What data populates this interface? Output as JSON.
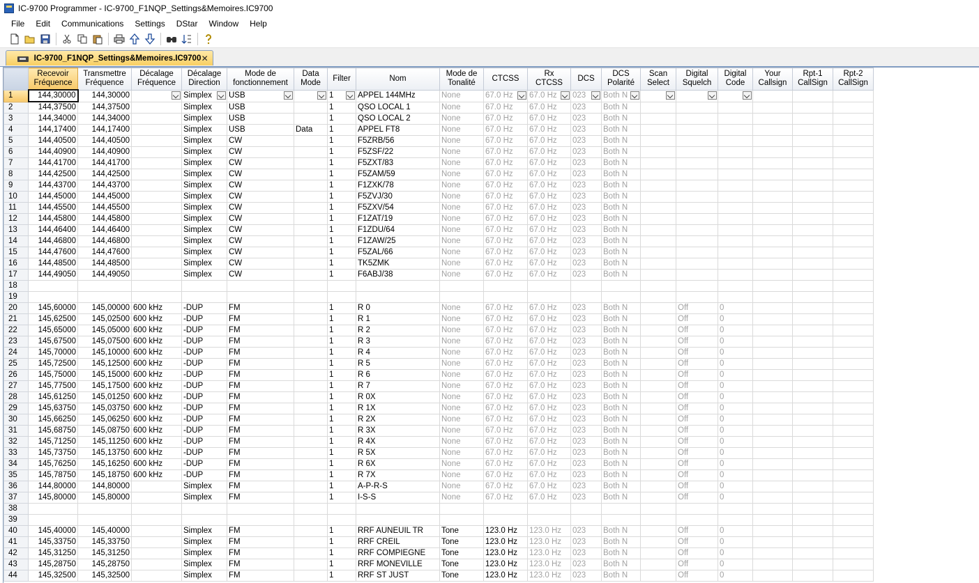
{
  "window": {
    "title": "IC-9700 Programmer - IC-9700_F1NQP_Settings&Memoires.IC9700"
  },
  "menu": [
    "File",
    "Edit",
    "Communications",
    "Settings",
    "DStar",
    "Window",
    "Help"
  ],
  "toolbar_icons": [
    "new-file-icon",
    "open-folder-icon",
    "save-icon",
    "cut-icon",
    "copy-icon",
    "paste-icon",
    "print-icon",
    "move-up-icon",
    "move-down-icon",
    "find-icon",
    "sort-icon",
    "help-icon"
  ],
  "tab": {
    "label": "IC-9700_F1NQP_Settings&Memoires.IC9700",
    "close": "✕"
  },
  "columns": [
    [
      "Recevoir",
      "Fréquence"
    ],
    [
      "Transmettre",
      "Fréquence"
    ],
    [
      "Décalage",
      "Fréquence"
    ],
    [
      "Décalage",
      "Direction"
    ],
    [
      "Mode de",
      "fonctionnement"
    ],
    [
      "Data",
      "Mode"
    ],
    [
      "Filter",
      ""
    ],
    [
      "Nom",
      ""
    ],
    [
      "Mode de",
      "Tonalité"
    ],
    [
      "CTCSS",
      ""
    ],
    [
      "Rx",
      "CTCSS"
    ],
    [
      "DCS",
      ""
    ],
    [
      "DCS",
      "Polarité"
    ],
    [
      "Scan",
      "Select"
    ],
    [
      "Digital",
      "Squelch"
    ],
    [
      "Digital",
      "Code"
    ],
    [
      "Your",
      "Callsign"
    ],
    [
      "Rpt-1",
      "CallSign"
    ],
    [
      "Rpt-2",
      "CallSign"
    ]
  ],
  "rows": [
    {
      "n": "1",
      "c": [
        "144,30000",
        "144,30000",
        "",
        "Simplex",
        "USB",
        "",
        "1",
        "APPEL 144MHz",
        "None",
        "67.0 Hz",
        "67.0 Hz",
        "023",
        "Both N",
        "",
        "",
        "",
        "",
        "",
        ""
      ]
    },
    {
      "n": "2",
      "c": [
        "144,37500",
        "144,37500",
        "",
        "Simplex",
        "USB",
        "",
        "1",
        "QSO LOCAL 1",
        "None",
        "67.0 Hz",
        "67.0 Hz",
        "023",
        "Both N",
        "",
        "",
        "",
        "",
        "",
        ""
      ]
    },
    {
      "n": "3",
      "c": [
        "144,34000",
        "144,34000",
        "",
        "Simplex",
        "USB",
        "",
        "1",
        "QSO LOCAL 2",
        "None",
        "67.0 Hz",
        "67.0 Hz",
        "023",
        "Both N",
        "",
        "",
        "",
        "",
        "",
        ""
      ]
    },
    {
      "n": "4",
      "c": [
        "144,17400",
        "144,17400",
        "",
        "Simplex",
        "USB",
        "Data",
        "1",
        "APPEL FT8",
        "None",
        "67.0 Hz",
        "67.0 Hz",
        "023",
        "Both N",
        "",
        "",
        "",
        "",
        "",
        ""
      ]
    },
    {
      "n": "5",
      "c": [
        "144,40500",
        "144,40500",
        "",
        "Simplex",
        "CW",
        "",
        "1",
        "F5ZRB/56",
        "None",
        "67.0 Hz",
        "67.0 Hz",
        "023",
        "Both N",
        "",
        "",
        "",
        "",
        "",
        ""
      ]
    },
    {
      "n": "6",
      "c": [
        "144,40900",
        "144,40900",
        "",
        "Simplex",
        "CW",
        "",
        "1",
        "F5ZSF/22",
        "None",
        "67.0 Hz",
        "67.0 Hz",
        "023",
        "Both N",
        "",
        "",
        "",
        "",
        "",
        ""
      ]
    },
    {
      "n": "7",
      "c": [
        "144,41700",
        "144,41700",
        "",
        "Simplex",
        "CW",
        "",
        "1",
        "F5ZXT/83",
        "None",
        "67.0 Hz",
        "67.0 Hz",
        "023",
        "Both N",
        "",
        "",
        "",
        "",
        "",
        ""
      ]
    },
    {
      "n": "8",
      "c": [
        "144,42500",
        "144,42500",
        "",
        "Simplex",
        "CW",
        "",
        "1",
        "F5ZAM/59",
        "None",
        "67.0 Hz",
        "67.0 Hz",
        "023",
        "Both N",
        "",
        "",
        "",
        "",
        "",
        ""
      ]
    },
    {
      "n": "9",
      "c": [
        "144,43700",
        "144,43700",
        "",
        "Simplex",
        "CW",
        "",
        "1",
        "F1ZXK/78",
        "None",
        "67.0 Hz",
        "67.0 Hz",
        "023",
        "Both N",
        "",
        "",
        "",
        "",
        "",
        ""
      ]
    },
    {
      "n": "10",
      "c": [
        "144,45000",
        "144,45000",
        "",
        "Simplex",
        "CW",
        "",
        "1",
        "F5ZVJ/30",
        "None",
        "67.0 Hz",
        "67.0 Hz",
        "023",
        "Both N",
        "",
        "",
        "",
        "",
        "",
        ""
      ]
    },
    {
      "n": "11",
      "c": [
        "144,45500",
        "144,45500",
        "",
        "Simplex",
        "CW",
        "",
        "1",
        "F5ZXV/54",
        "None",
        "67.0 Hz",
        "67.0 Hz",
        "023",
        "Both N",
        "",
        "",
        "",
        "",
        "",
        ""
      ]
    },
    {
      "n": "12",
      "c": [
        "144,45800",
        "144,45800",
        "",
        "Simplex",
        "CW",
        "",
        "1",
        "F1ZAT/19",
        "None",
        "67.0 Hz",
        "67.0 Hz",
        "023",
        "Both N",
        "",
        "",
        "",
        "",
        "",
        ""
      ]
    },
    {
      "n": "13",
      "c": [
        "144,46400",
        "144,46400",
        "",
        "Simplex",
        "CW",
        "",
        "1",
        "F1ZDU/64",
        "None",
        "67.0 Hz",
        "67.0 Hz",
        "023",
        "Both N",
        "",
        "",
        "",
        "",
        "",
        ""
      ]
    },
    {
      "n": "14",
      "c": [
        "144,46800",
        "144,46800",
        "",
        "Simplex",
        "CW",
        "",
        "1",
        "F1ZAW/25",
        "None",
        "67.0 Hz",
        "67.0 Hz",
        "023",
        "Both N",
        "",
        "",
        "",
        "",
        "",
        ""
      ]
    },
    {
      "n": "15",
      "c": [
        "144,47600",
        "144,47600",
        "",
        "Simplex",
        "CW",
        "",
        "1",
        "F5ZAL/66",
        "None",
        "67.0 Hz",
        "67.0 Hz",
        "023",
        "Both N",
        "",
        "",
        "",
        "",
        "",
        ""
      ]
    },
    {
      "n": "16",
      "c": [
        "144,48500",
        "144,48500",
        "",
        "Simplex",
        "CW",
        "",
        "1",
        "TK5ZMK",
        "None",
        "67.0 Hz",
        "67.0 Hz",
        "023",
        "Both N",
        "",
        "",
        "",
        "",
        "",
        ""
      ]
    },
    {
      "n": "17",
      "c": [
        "144,49050",
        "144,49050",
        "",
        "Simplex",
        "CW",
        "",
        "1",
        "F6ABJ/38",
        "None",
        "67.0 Hz",
        "67.0 Hz",
        "023",
        "Both N",
        "",
        "",
        "",
        "",
        "",
        ""
      ]
    },
    {
      "n": "18",
      "c": [
        "",
        "",
        "",
        "",
        "",
        "",
        "",
        "",
        "",
        "",
        "",
        "",
        "",
        "",
        "",
        "",
        "",
        "",
        ""
      ]
    },
    {
      "n": "19",
      "c": [
        "",
        "",
        "",
        "",
        "",
        "",
        "",
        "",
        "",
        "",
        "",
        "",
        "",
        "",
        "",
        "",
        "",
        "",
        ""
      ]
    },
    {
      "n": "20",
      "c": [
        "145,60000",
        "145,00000",
        "600 kHz",
        "-DUP",
        "FM",
        "",
        "1",
        "R 0",
        "None",
        "67.0 Hz",
        "67.0 Hz",
        "023",
        "Both N",
        "",
        "Off",
        "0",
        "",
        "",
        ""
      ]
    },
    {
      "n": "21",
      "c": [
        "145,62500",
        "145,02500",
        "600 kHz",
        "-DUP",
        "FM",
        "",
        "1",
        "R 1",
        "None",
        "67.0 Hz",
        "67.0 Hz",
        "023",
        "Both N",
        "",
        "Off",
        "0",
        "",
        "",
        ""
      ]
    },
    {
      "n": "22",
      "c": [
        "145,65000",
        "145,05000",
        "600 kHz",
        "-DUP",
        "FM",
        "",
        "1",
        "R 2",
        "None",
        "67.0 Hz",
        "67.0 Hz",
        "023",
        "Both N",
        "",
        "Off",
        "0",
        "",
        "",
        ""
      ]
    },
    {
      "n": "23",
      "c": [
        "145,67500",
        "145,07500",
        "600 kHz",
        "-DUP",
        "FM",
        "",
        "1",
        "R 3",
        "None",
        "67.0 Hz",
        "67.0 Hz",
        "023",
        "Both N",
        "",
        "Off",
        "0",
        "",
        "",
        ""
      ]
    },
    {
      "n": "24",
      "c": [
        "145,70000",
        "145,10000",
        "600 kHz",
        "-DUP",
        "FM",
        "",
        "1",
        "R 4",
        "None",
        "67.0 Hz",
        "67.0 Hz",
        "023",
        "Both N",
        "",
        "Off",
        "0",
        "",
        "",
        ""
      ]
    },
    {
      "n": "25",
      "c": [
        "145,72500",
        "145,12500",
        "600 kHz",
        "-DUP",
        "FM",
        "",
        "1",
        "R 5",
        "None",
        "67.0 Hz",
        "67.0 Hz",
        "023",
        "Both N",
        "",
        "Off",
        "0",
        "",
        "",
        ""
      ]
    },
    {
      "n": "26",
      "c": [
        "145,75000",
        "145,15000",
        "600 kHz",
        "-DUP",
        "FM",
        "",
        "1",
        "R 6",
        "None",
        "67.0 Hz",
        "67.0 Hz",
        "023",
        "Both N",
        "",
        "Off",
        "0",
        "",
        "",
        ""
      ]
    },
    {
      "n": "27",
      "c": [
        "145,77500",
        "145,17500",
        "600 kHz",
        "-DUP",
        "FM",
        "",
        "1",
        "R 7",
        "None",
        "67.0 Hz",
        "67.0 Hz",
        "023",
        "Both N",
        "",
        "Off",
        "0",
        "",
        "",
        ""
      ]
    },
    {
      "n": "28",
      "c": [
        "145,61250",
        "145,01250",
        "600 kHz",
        "-DUP",
        "FM",
        "",
        "1",
        "R 0X",
        "None",
        "67.0 Hz",
        "67.0 Hz",
        "023",
        "Both N",
        "",
        "Off",
        "0",
        "",
        "",
        ""
      ]
    },
    {
      "n": "29",
      "c": [
        "145,63750",
        "145,03750",
        "600 kHz",
        "-DUP",
        "FM",
        "",
        "1",
        "R 1X",
        "None",
        "67.0 Hz",
        "67.0 Hz",
        "023",
        "Both N",
        "",
        "Off",
        "0",
        "",
        "",
        ""
      ]
    },
    {
      "n": "30",
      "c": [
        "145,66250",
        "145,06250",
        "600 kHz",
        "-DUP",
        "FM",
        "",
        "1",
        "R 2X",
        "None",
        "67.0 Hz",
        "67.0 Hz",
        "023",
        "Both N",
        "",
        "Off",
        "0",
        "",
        "",
        ""
      ]
    },
    {
      "n": "31",
      "c": [
        "145,68750",
        "145,08750",
        "600 kHz",
        "-DUP",
        "FM",
        "",
        "1",
        "R 3X",
        "None",
        "67.0 Hz",
        "67.0 Hz",
        "023",
        "Both N",
        "",
        "Off",
        "0",
        "",
        "",
        ""
      ]
    },
    {
      "n": "32",
      "c": [
        "145,71250",
        "145,11250",
        "600 kHz",
        "-DUP",
        "FM",
        "",
        "1",
        "R 4X",
        "None",
        "67.0 Hz",
        "67.0 Hz",
        "023",
        "Both N",
        "",
        "Off",
        "0",
        "",
        "",
        ""
      ]
    },
    {
      "n": "33",
      "c": [
        "145,73750",
        "145,13750",
        "600 kHz",
        "-DUP",
        "FM",
        "",
        "1",
        "R 5X",
        "None",
        "67.0 Hz",
        "67.0 Hz",
        "023",
        "Both N",
        "",
        "Off",
        "0",
        "",
        "",
        ""
      ]
    },
    {
      "n": "34",
      "c": [
        "145,76250",
        "145,16250",
        "600 kHz",
        "-DUP",
        "FM",
        "",
        "1",
        "R 6X",
        "None",
        "67.0 Hz",
        "67.0 Hz",
        "023",
        "Both N",
        "",
        "Off",
        "0",
        "",
        "",
        ""
      ]
    },
    {
      "n": "35",
      "c": [
        "145,78750",
        "145,18750",
        "600 kHz",
        "-DUP",
        "FM",
        "",
        "1",
        "R 7X",
        "None",
        "67.0 Hz",
        "67.0 Hz",
        "023",
        "Both N",
        "",
        "Off",
        "0",
        "",
        "",
        ""
      ]
    },
    {
      "n": "36",
      "c": [
        "144,80000",
        "144,80000",
        "",
        "Simplex",
        "FM",
        "",
        "1",
        "A-P-R-S",
        "None",
        "67.0 Hz",
        "67.0 Hz",
        "023",
        "Both N",
        "",
        "Off",
        "0",
        "",
        "",
        ""
      ]
    },
    {
      "n": "37",
      "c": [
        "145,80000",
        "145,80000",
        "",
        "Simplex",
        "FM",
        "",
        "1",
        "I-S-S",
        "None",
        "67.0 Hz",
        "67.0 Hz",
        "023",
        "Both N",
        "",
        "Off",
        "0",
        "",
        "",
        ""
      ]
    },
    {
      "n": "38",
      "c": [
        "",
        "",
        "",
        "",
        "",
        "",
        "",
        "",
        "",
        "",
        "",
        "",
        "",
        "",
        "",
        "",
        "",
        "",
        ""
      ]
    },
    {
      "n": "39",
      "c": [
        "",
        "",
        "",
        "",
        "",
        "",
        "",
        "",
        "",
        "",
        "",
        "",
        "",
        "",
        "",
        "",
        "",
        "",
        ""
      ]
    },
    {
      "n": "40",
      "c": [
        "145,40000",
        "145,40000",
        "",
        "Simplex",
        "FM",
        "",
        "1",
        "RRF AUNEUIL TR",
        "Tone",
        "123.0 Hz",
        "123.0 Hz",
        "023",
        "Both N",
        "",
        "Off",
        "0",
        "",
        "",
        ""
      ]
    },
    {
      "n": "41",
      "c": [
        "145,33750",
        "145,33750",
        "",
        "Simplex",
        "FM",
        "",
        "1",
        "RRF CREIL",
        "Tone",
        "123.0 Hz",
        "123.0 Hz",
        "023",
        "Both N",
        "",
        "Off",
        "0",
        "",
        "",
        ""
      ]
    },
    {
      "n": "42",
      "c": [
        "145,31250",
        "145,31250",
        "",
        "Simplex",
        "FM",
        "",
        "1",
        "RRF COMPIEGNE",
        "Tone",
        "123.0 Hz",
        "123.0 Hz",
        "023",
        "Both N",
        "",
        "Off",
        "0",
        "",
        "",
        ""
      ]
    },
    {
      "n": "43",
      "c": [
        "145,28750",
        "145,28750",
        "",
        "Simplex",
        "FM",
        "",
        "1",
        "RRF MONEVILLE",
        "Tone",
        "123.0 Hz",
        "123.0 Hz",
        "023",
        "Both N",
        "",
        "Off",
        "0",
        "",
        "",
        ""
      ]
    },
    {
      "n": "44",
      "c": [
        "145,32500",
        "145,32500",
        "",
        "Simplex",
        "FM",
        "",
        "1",
        "RRF ST JUST",
        "Tone",
        "123.0 Hz",
        "123.0 Hz",
        "023",
        "Both N",
        "",
        "Off",
        "0",
        "",
        "",
        ""
      ]
    }
  ]
}
